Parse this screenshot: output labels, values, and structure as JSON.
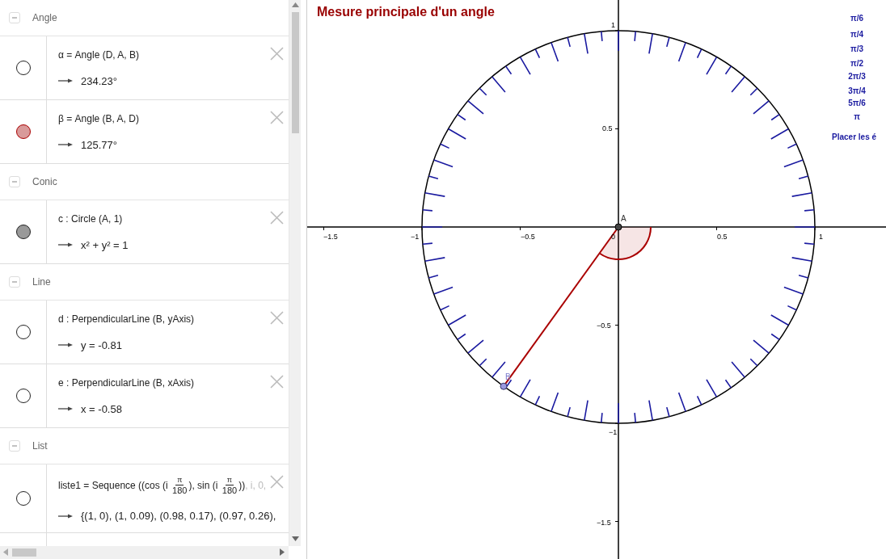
{
  "algebra": {
    "groups": [
      {
        "title": "Angle",
        "expanded": true,
        "items": [
          {
            "definition": [
              {
                "kind": "text",
                "text": "α = Angle (D, A, B)"
              }
            ],
            "value": "234.23°",
            "visible": false
          },
          {
            "definition": [
              {
                "kind": "text",
                "text": "β = Angle (B, A, D)"
              }
            ],
            "value": "125.77°",
            "visible": true,
            "color": "#d99a9a"
          }
        ]
      },
      {
        "title": "Conic",
        "expanded": true,
        "items": [
          {
            "definition": [
              {
                "kind": "text",
                "text": "c : Circle (A, 1)"
              }
            ],
            "value": "x² + y² = 1",
            "visible": true,
            "color": "#999999"
          }
        ]
      },
      {
        "title": "Line",
        "expanded": true,
        "items": [
          {
            "definition": [
              {
                "kind": "text",
                "text": "d : PerpendicularLine (B, yAxis)"
              }
            ],
            "value": "y = -0.81",
            "visible": false
          },
          {
            "definition": [
              {
                "kind": "text",
                "text": "e : PerpendicularLine (B, xAxis)"
              }
            ],
            "value": "x = -0.58",
            "visible": false
          }
        ]
      },
      {
        "title": "List",
        "expanded": true,
        "items": [
          {
            "definition": [
              {
                "kind": "text",
                "text": "liste1 = Sequence (("
              },
              {
                "kind": "text",
                "text": "cos (i "
              },
              {
                "kind": "frac",
                "num": "π",
                "den": "180"
              },
              {
                "kind": "text",
                "text": "), sin (i "
              },
              {
                "kind": "frac",
                "num": "π",
                "den": "180"
              },
              {
                "kind": "text",
                "text": "))"
              },
              {
                "kind": "faded",
                "text": ", i, 0,"
              }
            ],
            "value": "{(1, 0), (1, 0.09), (0.98, 0.17), (0.97, 0.26),",
            "visible": false
          }
        ]
      }
    ]
  },
  "graphics": {
    "title": "Mesure principale d'un angle",
    "x_labels": [
      "−1.5",
      "−1",
      "−0.5",
      "0",
      "0.5",
      "1"
    ],
    "y_labels": [
      "1",
      "0.5",
      "−0.5",
      "−1",
      "−1.5"
    ],
    "points": [
      {
        "label": "A"
      },
      {
        "label": "B"
      }
    ],
    "angle_buttons": [
      "π/6",
      "π/4",
      "π/3",
      "π/2",
      "2π/3",
      "3π/4",
      "5π/6",
      "π"
    ],
    "place_button": "Placer les é"
  }
}
